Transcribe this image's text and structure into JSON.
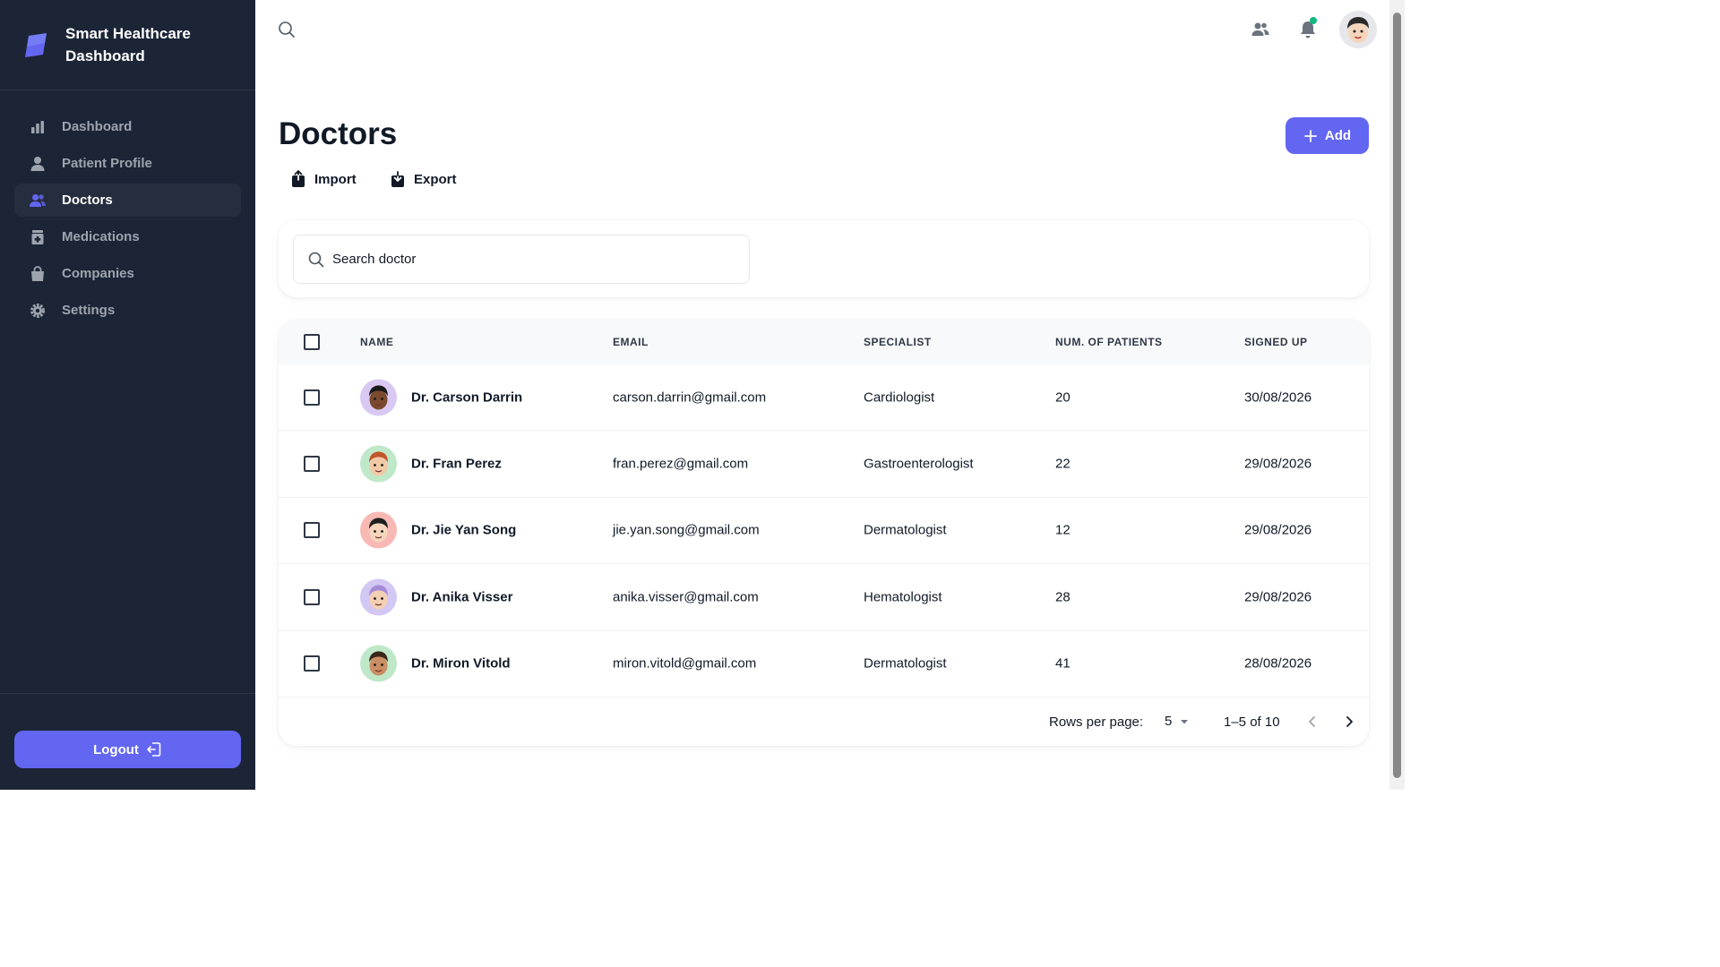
{
  "app": {
    "title": "Smart Healthcare Dashboard"
  },
  "sidebar": {
    "items": [
      {
        "label": "Dashboard",
        "icon": "bar-chart-icon",
        "active": false
      },
      {
        "label": "Patient Profile",
        "icon": "user-icon",
        "active": false
      },
      {
        "label": "Doctors",
        "icon": "users-icon",
        "active": true
      },
      {
        "label": "Medications",
        "icon": "medicine-box-icon",
        "active": false
      },
      {
        "label": "Companies",
        "icon": "shopping-bag-icon",
        "active": false
      },
      {
        "label": "Settings",
        "icon": "gear-icon",
        "active": false
      }
    ],
    "logout_label": "Logout"
  },
  "topbar": {
    "icons": [
      "search-icon",
      "contacts-icon",
      "bell-icon",
      "user-avatar"
    ],
    "notification_dot": true
  },
  "page": {
    "title": "Doctors",
    "add_label": "Add",
    "import_label": "Import",
    "export_label": "Export"
  },
  "search": {
    "placeholder": "Search doctor",
    "value": ""
  },
  "table": {
    "columns": [
      "NAME",
      "EMAIL",
      "SPECIALIST",
      "NUM. OF PATIENTS",
      "SIGNED UP"
    ],
    "rows": [
      {
        "name": "Dr. Carson Darrin",
        "email": "carson.darrin@gmail.com",
        "specialist": "Cardiologist",
        "patients": "20",
        "signed_up": "30/08/2026",
        "avatar_bg": "#d9c9f2",
        "skin": "#7a4a2e",
        "hair": "#1a1a1a"
      },
      {
        "name": "Dr. Fran Perez",
        "email": "fran.perez@gmail.com",
        "specialist": "Gastroenterologist",
        "patients": "22",
        "signed_up": "29/08/2026",
        "avatar_bg": "#bfe8c8",
        "skin": "#f2c9a6",
        "hair": "#c2552b"
      },
      {
        "name": "Dr. Jie Yan Song",
        "email": "jie.yan.song@gmail.com",
        "specialist": "Dermatologist",
        "patients": "12",
        "signed_up": "29/08/2026",
        "avatar_bg": "#f8b9b4",
        "skin": "#f5d6bd",
        "hair": "#1f1f1f"
      },
      {
        "name": "Dr. Anika Visser",
        "email": "anika.visser@gmail.com",
        "specialist": "Hematologist",
        "patients": "28",
        "signed_up": "29/08/2026",
        "avatar_bg": "#d3c7f4",
        "skin": "#f3d0b4",
        "hair": "#a88bd8"
      },
      {
        "name": "Dr. Miron Vitold",
        "email": "miron.vitold@gmail.com",
        "specialist": "Dermatologist",
        "patients": "41",
        "signed_up": "28/08/2026",
        "avatar_bg": "#bfe8c8",
        "skin": "#c98e63",
        "hair": "#3a2619"
      }
    ]
  },
  "pagination": {
    "rows_per_page_label": "Rows per page:",
    "rows_per_page": "5",
    "range": "1–5 of 10"
  },
  "colors": {
    "sidebar_bg": "#1c2536",
    "accent": "#6366f1",
    "notification": "#10b981"
  }
}
